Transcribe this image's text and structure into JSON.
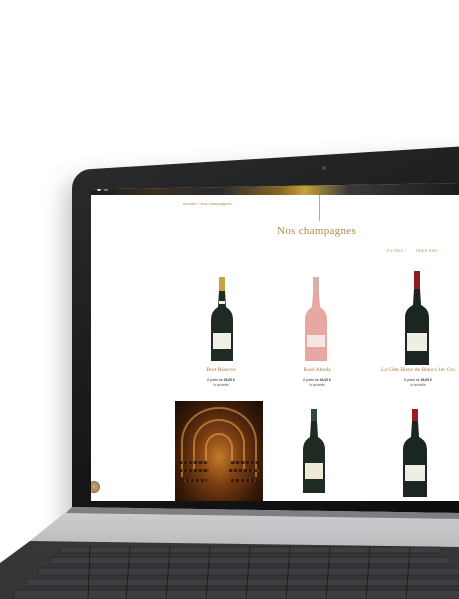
{
  "site": {
    "breadcrumb": "Accueil  >  Nos champagnes",
    "page_title": "Nos champagnes",
    "filters": {
      "filter_label": "FILTRES  ›",
      "sort_label": "TRIER PAR  ›"
    },
    "help_label": "?"
  },
  "products": [
    {
      "name": "Brut Réserve",
      "price_prefix": "À partir de ",
      "price": "28,00 €",
      "sub": "la bouteille",
      "bottle_color": "#1e2a22",
      "label_color": "#f2efe6",
      "cap_color": "#c9a244"
    },
    {
      "name": "Rosé Akoda",
      "price_prefix": "À partir de ",
      "price": "44,00 €",
      "sub": "la bouteille",
      "bottle_color": "#e8a7a0",
      "label_color": "#f4e8e6",
      "cap_color": "#d9b0a8"
    },
    {
      "name": "La Côte Blanc de Blancs 1er Cru",
      "price_prefix": "À partir de ",
      "price": "45,00 €",
      "sub": "la bouteille",
      "bottle_color": "#1b2620",
      "label_color": "#f0ede4",
      "cap_color": "#8b1d22"
    },
    {
      "name": "",
      "bottle_color": "#1e2a22",
      "label_color": "#efe9d8",
      "cap_color": "#2f4a3a"
    },
    {
      "name": "",
      "bottle_color": "#1b2620",
      "label_color": "#f0ede4",
      "cap_color": "#9a1c22"
    }
  ],
  "colors": {
    "accent": "#b08a4a",
    "title": "#a6783c",
    "laptop": "#161617"
  }
}
